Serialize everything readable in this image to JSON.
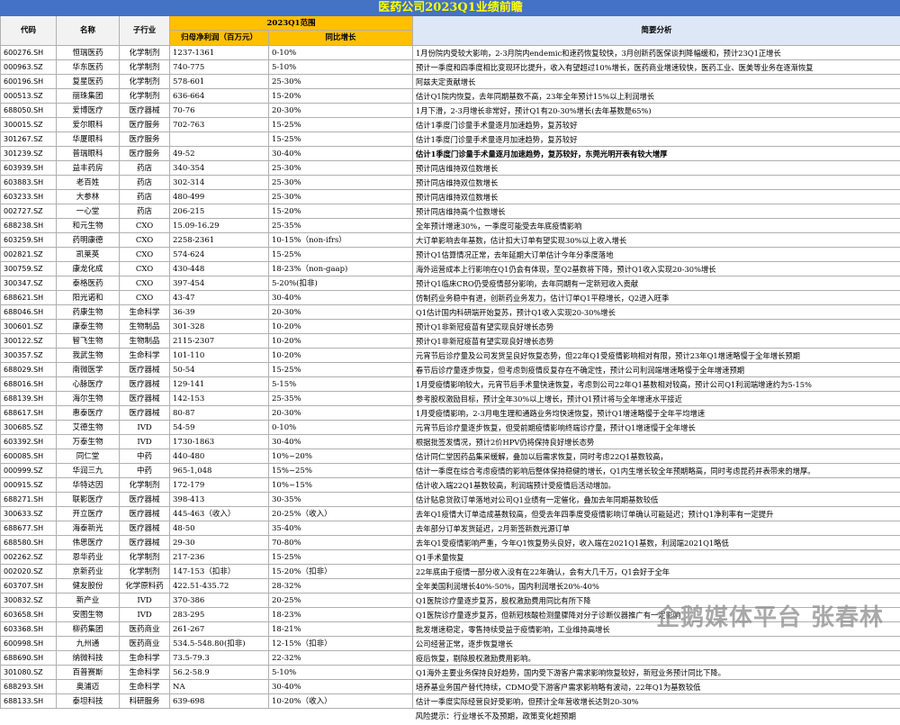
{
  "title": "医药公司2023Q1业绩前瞻",
  "headers": {
    "code": "代码",
    "name": "名称",
    "industry": "子行业",
    "range": "2023Q1范围",
    "profit": "归母净利润（百万元）",
    "growth": "同比增长",
    "analysis": "简要分析"
  },
  "rows": [
    {
      "code": "600276.SH",
      "name": "恒瑞医药",
      "industry": "化学制剂",
      "profit": "1237-1361",
      "growth": "0-10%",
      "analysis": "1月份院内受较大影响，2-3月院内endemic和速药恢复较快，3月创新药医保谈判降幅缓和，预计23Q1正增长"
    },
    {
      "code": "000963.SZ",
      "name": "华东医药",
      "industry": "化学制剂",
      "profit": "740-775",
      "growth": "5-10%",
      "analysis": "预计一季度和四季度相比变现环比提升，收入有望超过10%增长，医药商业增速较快，医药工业、医美等业务在逐渐恢复"
    },
    {
      "code": "600196.SH",
      "name": "复星医药",
      "industry": "化学制剂",
      "profit": "578-601",
      "growth": "25-30%",
      "analysis": "阿兹夫定贡献增长"
    },
    {
      "code": "000513.SZ",
      "name": "丽珠集团",
      "industry": "化学制剂",
      "profit": "636-664",
      "growth": "15-20%",
      "analysis": "估计Q1院内恢复，去年同期基数不高，23年全年预计15%以上利润增长"
    },
    {
      "code": "688050.SH",
      "name": "爱博医疗",
      "industry": "医疗器械",
      "profit": "70-76",
      "growth": "20-30%",
      "analysis": "1月下滑，2-3月增长非常好，预计Q1有20-30%增长(去年基数是65%)"
    },
    {
      "code": "300015.SZ",
      "name": "爱尔眼科",
      "industry": "医疗服务",
      "profit": "702-763",
      "growth": "15-25%",
      "analysis": "估计1季度门诊量手术量逐月加速趋势，复苏较好"
    },
    {
      "code": "301267.SZ",
      "name": "华厦眼科",
      "industry": "医疗服务",
      "profit": "",
      "growth": "15-25%",
      "analysis": "估计1季度门诊量手术量逐月加速趋势，复苏较好"
    },
    {
      "code": "301239.SZ",
      "name": "普瑞眼科",
      "industry": "医疗服务",
      "profit": "49-52",
      "growth": "30-40%",
      "analysis": "估计1季度门诊量手术量逐月加速趋势，复苏较好，东莞光明开表有较大增厚",
      "bold": true
    },
    {
      "code": "603939.SH",
      "name": "益丰药房",
      "industry": "药店",
      "profit": "340-354",
      "growth": "25-30%",
      "analysis": "预计同店维持双位数增长"
    },
    {
      "code": "603883.SH",
      "name": "老百姓",
      "industry": "药店",
      "profit": "302-314",
      "growth": "25-30%",
      "analysis": "预计同店维持双位数增长"
    },
    {
      "code": "603233.SH",
      "name": "大参林",
      "industry": "药店",
      "profit": "480-499",
      "growth": "25-30%",
      "analysis": "预计同店维持双位数增长"
    },
    {
      "code": "002727.SZ",
      "name": "一心堂",
      "industry": "药店",
      "profit": "206-215",
      "growth": "15-20%",
      "analysis": "预计同店维持高个位数增长"
    },
    {
      "code": "688238.SH",
      "name": "和元生物",
      "industry": "CXO",
      "profit": "15.09-16.29",
      "growth": "25-35%",
      "analysis": "全年预计增速30%，一季度可能受去年底疫情影响"
    },
    {
      "code": "603259.SH",
      "name": "药明康德",
      "industry": "CXO",
      "profit": "2258-2361",
      "growth": "10-15%（non-ifrs）",
      "analysis": "大订单影响去年基数，估计扣大订单有望实现30%以上收入增长"
    },
    {
      "code": "002821.SZ",
      "name": "凯莱英",
      "industry": "CXO",
      "profit": "574-624",
      "growth": "15-25%",
      "analysis": "预计Q1估算情况正常，去年延期大订单估计今年分季度落地"
    },
    {
      "code": "300759.SZ",
      "name": "康龙化成",
      "industry": "CXO",
      "profit": "430-448",
      "growth": "18-23%（non-gaap)",
      "analysis": "海外运营成本上行影响在Q1仍会有体现，至Q2基数将下降，预计Q1收入实现20-30%增长"
    },
    {
      "code": "300347.SZ",
      "name": "泰格医药",
      "industry": "CXO",
      "profit": "397-454",
      "growth": "5-20%(扣非)",
      "analysis": "预计Q1临床CRO仍受疫情部分影响，去年同期有一定新冠收入贡献"
    },
    {
      "code": "688621.SH",
      "name": "阳光诺和",
      "industry": "CXO",
      "profit": "43-47",
      "growth": "30-40%",
      "analysis": "仿制药业务稳中有进，创新药业务发力，估计订单Q1平稳增长，Q2进入旺季"
    },
    {
      "code": "688046.SH",
      "name": "药康生物",
      "industry": "生命科学",
      "profit": "36-39",
      "growth": "20-30%",
      "analysis": "Q1估计国内科研端开始复苏，预计Q1收入实现20-30%增长"
    },
    {
      "code": "300601.SZ",
      "name": "康泰生物",
      "industry": "生物制品",
      "profit": "301-328",
      "growth": "10-20%",
      "analysis": "预计Q1非新冠疫苗有望实现良好增长态势"
    },
    {
      "code": "300122.SZ",
      "name": "智飞生物",
      "industry": "生物制品",
      "profit": "2115-2307",
      "growth": "10-20%",
      "analysis": "预计Q1非新冠疫苗有望实现良好增长态势"
    },
    {
      "code": "300357.SZ",
      "name": "我武生物",
      "industry": "生命科学",
      "profit": "101-110",
      "growth": "10-20%",
      "analysis": "元宵节后诊疗量及公司发货呈良好恢复态势，但22年Q1受疫情影响相对有限，预计23年Q1增速略慢于全年增长预期"
    },
    {
      "code": "688029.SH",
      "name": "南微医学",
      "industry": "医疗器械",
      "profit": "50-54",
      "growth": "15-25%",
      "analysis": "春节后诊疗量逐步恢复，但考虑到疫情反复存在不确定性，预计公司利润端增速略慢于全年增速预期"
    },
    {
      "code": "688016.SH",
      "name": "心脉医疗",
      "industry": "医疗器械",
      "profit": "129-141",
      "growth": "5-15%",
      "analysis": "1月受疫情影响较大，元宵节后手术量快速恢复，考虑到公司22年Q1基数相对较高，预计公司Q1利润端增速约为5-15%"
    },
    {
      "code": "688139.SH",
      "name": "海尔生物",
      "industry": "医疗器械",
      "profit": "142-153",
      "growth": "25-35%",
      "analysis": "参考股权激励目标，预计全年30%以上增长，预计Q1预计将与全年增速水平接近"
    },
    {
      "code": "688617.SH",
      "name": "惠泰医疗",
      "industry": "医疗器械",
      "profit": "80-87",
      "growth": "20-30%",
      "analysis": "1月受疫情影响，2-3月电生理和通路业务均快速恢复，预计Q1增速略慢于全年平均增速"
    },
    {
      "code": "300685.SZ",
      "name": "艾德生物",
      "industry": "IVD",
      "profit": "54-59",
      "growth": "0-10%",
      "analysis": "元宵节后诊疗量逐步恢复，但受前期疫情影响终端诊疗量，预计Q1增速慢于全年增长"
    },
    {
      "code": "603392.SH",
      "name": "万泰生物",
      "industry": "IVD",
      "profit": "1730-1863",
      "growth": "30-40%",
      "analysis": "根据批签发情况，预计2价HPV仍将保持良好增长态势"
    },
    {
      "code": "600085.SH",
      "name": "同仁堂",
      "industry": "中药",
      "profit": "440-480",
      "growth": "10%~20%",
      "analysis": "估计同仁堂因药品集采缓解，叠加以后需求恢复，同时考虑22Q1基数较高，"
    },
    {
      "code": "000999.SZ",
      "name": "华润三九",
      "industry": "中药",
      "profit": "965-1,048",
      "growth": "15%~25%",
      "analysis": "估计一季度在综合考虑疫情的影响后整体保持稳健的增长，Q1内生增长较全年预期略高，同时考虑昆药并表带来的增厚。"
    },
    {
      "code": "000915.SZ",
      "name": "华特达因",
      "industry": "化学制剂",
      "profit": "172-179",
      "growth": "10%~15%",
      "analysis": "估计收入端22Q1基数较高，利润端预计受疫情后活动增加。"
    },
    {
      "code": "688271.SH",
      "name": "联影医疗",
      "industry": "医疗器械",
      "profit": "398-413",
      "growth": "30-35%",
      "analysis": "估计贴息贷款订单落地对公司Q1业绩有一定催化，叠加去年同期基数较低"
    },
    {
      "code": "300633.SZ",
      "name": "开立医疗",
      "industry": "医疗器械",
      "profit": "445-463（收入）",
      "growth": "20-25%（收入）",
      "analysis": "去年Q1疫情大订单造成基数较高，但受去年四季度受疫情影响订单确认可能延迟；预计Q1净利率有一定提升"
    },
    {
      "code": "688677.SH",
      "name": "海泰新光",
      "industry": "医疗器械",
      "profit": "48-50",
      "growth": "35-40%",
      "analysis": "去年部分订单发货延迟，2月新签新数光源订单"
    },
    {
      "code": "688580.SH",
      "name": "伟思医疗",
      "industry": "医疗器械",
      "profit": "29-30",
      "growth": "70-80%",
      "analysis": "去年Q1受疫情影响严重，今年Q1恢复势头良好，收入端在2021Q1基数，利润端2021Q1略低"
    },
    {
      "code": "002262.SZ",
      "name": "恩华药业",
      "industry": "化学制剂",
      "profit": "217-236",
      "growth": "15-25%",
      "analysis": "Q1手术量恢复"
    },
    {
      "code": "002020.SZ",
      "name": "京新药业",
      "industry": "化学制剂",
      "profit": "147-153（扣非）",
      "growth": "15-20%（扣非）",
      "analysis": "22年底由于疫情一部分收入没有在22年确认，会有大几千万，Q1会好于全年"
    },
    {
      "code": "603707.SH",
      "name": "健友股份",
      "industry": "化学原料药",
      "profit": "422.51-435.72",
      "growth": "28-32%",
      "analysis": "全年美国利润增长40%-50%，国内利润增长20%-40%"
    },
    {
      "code": "300832.SZ",
      "name": "新产业",
      "industry": "IVD",
      "profit": "370-386",
      "growth": "20-25%",
      "analysis": "Q1医院诊疗量逐步复苏，股权激励费用同比有所下降"
    },
    {
      "code": "603658.SH",
      "name": "安图生物",
      "industry": "IVD",
      "profit": "283-295",
      "growth": "18-23%",
      "analysis": "Q1医院诊疗量逐步复苏，但新冠核酸检测量骤降对分子诊断仪器推广有一定影响"
    },
    {
      "code": "603368.SH",
      "name": "柳药集团",
      "industry": "医药商业",
      "profit": "261-267",
      "growth": "18-21%",
      "analysis": "批发增速稳定，零售持续受益于疫情影响，工业维持高增长"
    },
    {
      "code": "600998.SH",
      "name": "九州通",
      "industry": "医药商业",
      "profit": "534.5-548.80(扣非)",
      "growth": "12-15%（扣非）",
      "analysis": "公司经营正常，逐步恢复增长"
    },
    {
      "code": "688690.SH",
      "name": "纳微科技",
      "industry": "生命科学",
      "profit": "73.5-79.3",
      "growth": "22-32%",
      "analysis": "疫后恢复，剔除股权激励费用影响。"
    },
    {
      "code": "301080.SZ",
      "name": "百普赛斯",
      "industry": "生命科学",
      "profit": "56.2-58.9",
      "growth": "5-10%",
      "analysis": "Q1海外主要业务保持良好趋势，国内受下游客户需求影响恢复较好，新冠业务预计同比下降。"
    },
    {
      "code": "688293.SH",
      "name": "奥浦迈",
      "industry": "生命科学",
      "profit": "NA",
      "growth": "30-40%",
      "analysis": "培养基业务国产替代持续，CDMO受下游客户需求影响略有波动，22年Q1为基数较低"
    },
    {
      "code": "688133.SH",
      "name": "泰坦科技",
      "industry": "科研服务",
      "profit": "639-698",
      "growth": "10-20%（收入）",
      "analysis": "估计一季度实际经营良好受影响，但预计全年营收增长达到20-30%"
    }
  ],
  "footer": "风险提示：行业增长不及预期，政策变化超预期",
  "watermark": "企鹅媒体平台 张春林"
}
